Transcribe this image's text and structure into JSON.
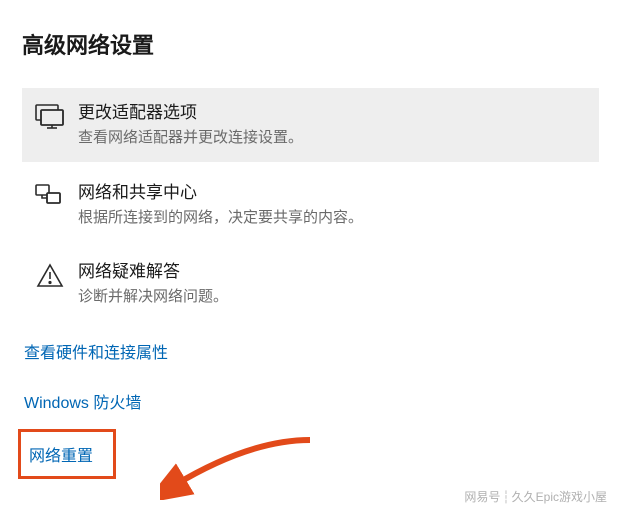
{
  "section_title": "高级网络设置",
  "items": [
    {
      "title": "更改适配器选项",
      "desc": "查看网络适配器并更改连接设置。"
    },
    {
      "title": "网络和共享中心",
      "desc": "根据所连接到的网络，决定要共享的内容。"
    },
    {
      "title": "网络疑难解答",
      "desc": "诊断并解决网络问题。"
    }
  ],
  "links": {
    "hardware": "查看硬件和连接属性",
    "firewall": "Windows 防火墙",
    "reset": "网络重置"
  },
  "watermark": {
    "left": "网易号",
    "right": "久久Epic游戏小屋"
  },
  "annotation": {
    "arrow_color": "#e24a1a",
    "box_color": "#e24a1a"
  }
}
